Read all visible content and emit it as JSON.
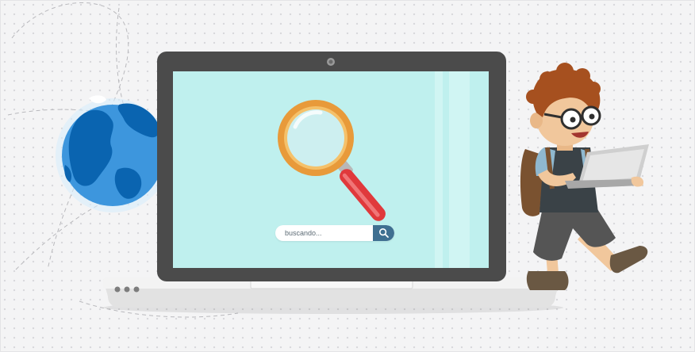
{
  "search": {
    "placeholder": "buscando..."
  },
  "icons": {
    "search_button": "search-icon",
    "magnifier": "magnifying-glass-icon",
    "globe": "globe-icon",
    "camera": "webcam-icon",
    "indicators": "status-dots-icon"
  },
  "colors": {
    "screen": "#bff0ee",
    "laptop_bezel": "#4b4b4b",
    "laptop_base": "#ececec",
    "magnifier_ring": "#e89a3a",
    "magnifier_handle": "#e0393c",
    "globe_ocean": "#3d96dd",
    "globe_land": "#0a64b0",
    "search_button": "#3f6f91"
  }
}
